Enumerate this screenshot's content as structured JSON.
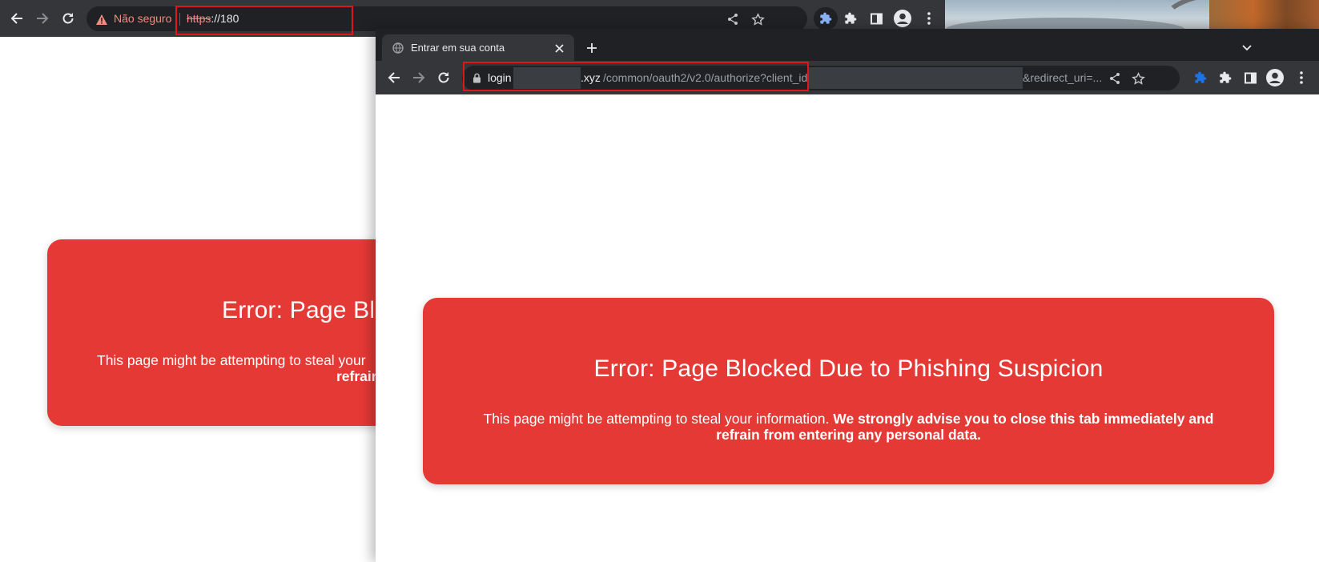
{
  "back_window": {
    "security_label": "Não seguro",
    "url_scheme": "https",
    "url_rest": "://180",
    "card": {
      "title": "Error: Page Blëc",
      "line1": "This page might be attempting to steal your",
      "line2_bold": "refrain"
    }
  },
  "front_window": {
    "tab_title": "Entrar em sua conta",
    "url_prefix": "login",
    "url_domain_suffix": ".xyz",
    "url_path": "/common/oauth2/v2.0/authorize?client_id=",
    "url_tail": "&redirect_uri=...",
    "card": {
      "title": "Error: Page Blocked Due to Phishing Suspicion",
      "text_normal": "This page might be attempting to steal your information. ",
      "text_bold": "We strongly advise you to close this tab immediately and refrain from entering any personal data."
    }
  },
  "colors": {
    "toolbar": "#35363a",
    "tabstrip": "#202124",
    "card_red": "#e53935",
    "highlight_red": "#e0161c",
    "warning": "#f28b82",
    "extension_blue": "#8ab4f8"
  },
  "icons": [
    "back-icon",
    "forward-icon",
    "reload-icon",
    "warning-icon",
    "lock-icon",
    "share-icon",
    "star-icon",
    "extension-icon",
    "puzzle-icon",
    "sidepanel-icon",
    "profile-icon",
    "menu-icon",
    "globe-icon",
    "close-icon",
    "plus-icon",
    "chevron-down-icon"
  ]
}
